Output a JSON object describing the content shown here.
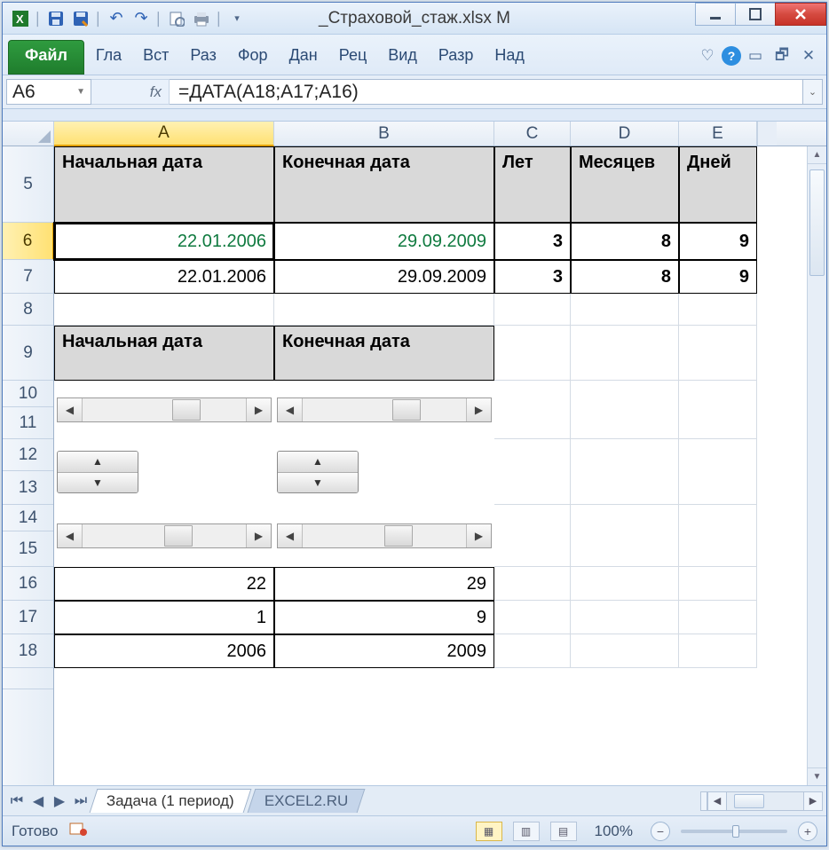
{
  "titlebar": {
    "doc_title": "_Страховой_стаж.xlsx M"
  },
  "ribbon": {
    "file": "Файл",
    "tabs": [
      "Гла",
      "Вст",
      "Раз",
      "Фор",
      "Дан",
      "Рец",
      "Вид",
      "Разр",
      "Над"
    ]
  },
  "formula": {
    "namebox": "A6",
    "fx": "fx",
    "formula": "=ДАТА(A18;A17;A16)"
  },
  "columns": [
    "A",
    "B",
    "C",
    "D",
    "E"
  ],
  "rows_visible": [
    "5",
    "6",
    "7",
    "8",
    "9",
    "10",
    "11",
    "12",
    "13",
    "14",
    "15",
    "16",
    "17",
    "18"
  ],
  "header5": {
    "A": "Начальная дата",
    "B": "Конечная дата",
    "C": "Лет",
    "D": "Месяцев",
    "E": "Дней"
  },
  "r6": {
    "A": "22.01.2006",
    "B": "29.09.2009",
    "C": "3",
    "D": "8",
    "E": "9"
  },
  "r7": {
    "A": "22.01.2006",
    "B": "29.09.2009",
    "C": "3",
    "D": "8",
    "E": "9"
  },
  "header9": {
    "A": "Начальная дата",
    "B": "Конечная дата"
  },
  "r16": {
    "A": "22",
    "B": "29"
  },
  "r17": {
    "A": "1",
    "B": "9"
  },
  "r18": {
    "A": "2006",
    "B": "2009"
  },
  "sheets": {
    "active": "Задача (1 период)",
    "second": "EXCEL2.RU"
  },
  "status": {
    "ready": "Готово",
    "zoom": "100%"
  }
}
